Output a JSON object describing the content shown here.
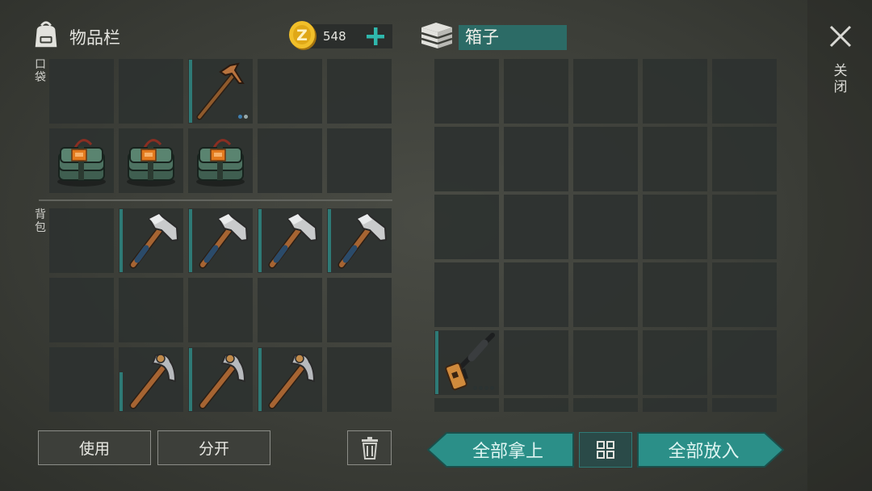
{
  "inventory": {
    "title": "物品栏",
    "coins": "548"
  },
  "sections": {
    "pocket_label": "口袋",
    "backpack_label": "背包"
  },
  "container": {
    "title": "箱子"
  },
  "close": {
    "label": "关闭"
  },
  "buttons": {
    "use": "使用",
    "split": "分开",
    "take_all": "全部拿上",
    "put_all": "全部放入"
  },
  "pocket_items": [
    {
      "icon": "pickaxe-icon",
      "durability": 1.0
    },
    {
      "icon": "c4-bomb-icon"
    },
    {
      "icon": "c4-bomb-icon"
    },
    {
      "icon": "c4-bomb-icon"
    }
  ],
  "backpack_items": [
    {
      "icon": "hammer-icon",
      "durability": 1.0
    },
    {
      "icon": "hammer-icon",
      "durability": 1.0
    },
    {
      "icon": "hammer-icon",
      "durability": 1.0
    },
    {
      "icon": "hammer-icon",
      "durability": 1.0
    },
    {
      "icon": "pickaxe-icon",
      "durability": 0.6
    },
    {
      "icon": "pickaxe-icon",
      "durability": 1.0
    },
    {
      "icon": "pickaxe-icon",
      "durability": 1.0
    }
  ],
  "chest_items": [
    {
      "icon": "rifle-icon",
      "durability": 1.0
    }
  ],
  "colors": {
    "accent": "#2aa39a",
    "coin": "#e8b423",
    "panel": "#2f3331"
  }
}
